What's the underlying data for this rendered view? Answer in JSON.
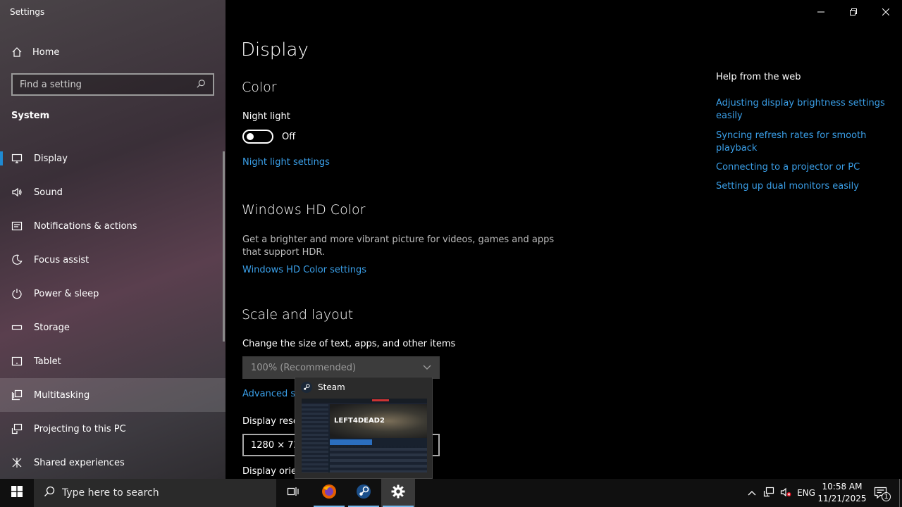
{
  "window": {
    "title": "Settings",
    "minimize_icon": "minimize-icon",
    "maximize_icon": "restore-icon",
    "close_icon": "close-icon"
  },
  "sidebar": {
    "home_label": "Home",
    "search_placeholder": "Find a setting",
    "section": "System",
    "items": [
      {
        "label": "Display",
        "icon": "monitor-icon",
        "selected": true
      },
      {
        "label": "Sound",
        "icon": "speaker-icon"
      },
      {
        "label": "Notifications & actions",
        "icon": "notification-icon"
      },
      {
        "label": "Focus assist",
        "icon": "moon-icon"
      },
      {
        "label": "Power & sleep",
        "icon": "power-icon"
      },
      {
        "label": "Storage",
        "icon": "storage-icon"
      },
      {
        "label": "Tablet",
        "icon": "tablet-icon"
      },
      {
        "label": "Multitasking",
        "icon": "multitasking-icon",
        "hover": true
      },
      {
        "label": "Projecting to this PC",
        "icon": "projecting-icon"
      },
      {
        "label": "Shared experiences",
        "icon": "shared-icon"
      }
    ]
  },
  "main": {
    "title": "Display",
    "color": {
      "heading": "Color",
      "night_light_label": "Night light",
      "night_light_state": "Off",
      "night_light_link": "Night light settings"
    },
    "hdr": {
      "heading": "Windows HD Color",
      "description": "Get a brighter and more vibrant picture for videos, games and apps that support HDR.",
      "link": "Windows HD Color settings"
    },
    "scale": {
      "heading": "Scale and layout",
      "size_label": "Change the size of text, apps, and other items",
      "size_value": "100% (Recommended)",
      "advanced_link": "Advanced sc",
      "resolution_label": "Display reso",
      "resolution_value": "1280 × 720",
      "orientation_label": "Display orie"
    }
  },
  "help": {
    "title": "Help from the web",
    "links": [
      "Adjusting display brightness settings easily",
      "Syncing refresh rates for smooth playback",
      "Connecting to a projector or PC",
      "Setting up dual monitors easily"
    ]
  },
  "thumbnail": {
    "app_name": "Steam",
    "preview_logo": "LEFT4DEAD2"
  },
  "taskbar": {
    "search_placeholder": "Type here to search",
    "language": "ENG",
    "time": "10:58 AM",
    "date": "11/21/2025",
    "notification_count": "1"
  }
}
